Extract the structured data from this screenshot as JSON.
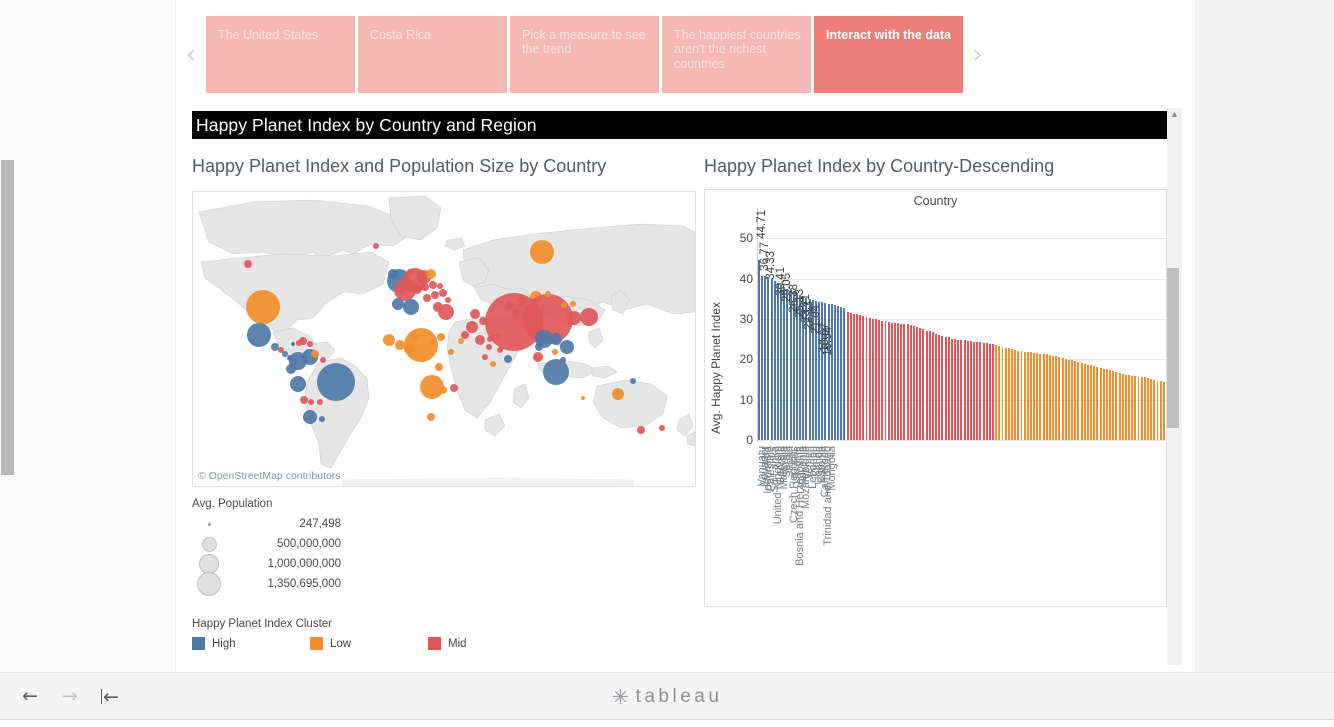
{
  "story": {
    "prev_icon": "chevron-left-icon",
    "next_icon": "chevron-right-icon",
    "tabs": [
      {
        "label": "The United States",
        "active": false
      },
      {
        "label": "Costa Rica",
        "active": false
      },
      {
        "label": "Pick a measure to see the trend",
        "active": false
      },
      {
        "label": "The happiest countries aren't the richest countries",
        "active": false
      },
      {
        "label": "Interact with the data",
        "active": true
      }
    ]
  },
  "dashboard": {
    "title": "Happy Planet Index by Country and Region",
    "map_sheet_title": "Happy Planet Index and Population Size by Country",
    "bar_sheet_title": "Happy Planet Index by Country-Descending",
    "map_attribution": "© OpenStreetMap contributors"
  },
  "legends": {
    "population": {
      "title": "Avg. Population",
      "items": [
        {
          "label": "247,498",
          "size": 3
        },
        {
          "label": "500,000,000",
          "size": 13
        },
        {
          "label": "1,000,000,000",
          "size": 18
        },
        {
          "label": "1,350,695,000",
          "size": 22
        }
      ]
    },
    "cluster": {
      "title": "Happy Planet Index Cluster",
      "items": [
        {
          "label": "High",
          "color": "#4E79A7"
        },
        {
          "label": "Low",
          "color": "#F28E2B"
        },
        {
          "label": "Mid",
          "color": "#E15759"
        }
      ]
    }
  },
  "colors": {
    "high": "#4E79A7",
    "low": "#F28E2B",
    "mid": "#E15759",
    "tab_inactive": "#f6b8b4",
    "tab_active": "#ee7e7a",
    "title_bar": "#000000"
  },
  "toolbar": {
    "back_icon": "arrow-left-icon",
    "forward_icon": "arrow-right-icon",
    "revert_icon": "revert-to-start-icon",
    "logo_text": "tableau"
  },
  "chart_data": {
    "type": "bar",
    "title": "Happy Planet Index by Country-Descending",
    "column_header": "Country",
    "xlabel": "Country",
    "ylabel": "Avg. Happy Planet Index",
    "ylim": [
      0,
      55
    ],
    "yticks": [
      0,
      10,
      20,
      30,
      40,
      50
    ],
    "grid": true,
    "legend_position": "below-map",
    "color_by": "Happy Planet Index Cluster",
    "labeled_points": [
      {
        "country": "Vanuatu",
        "value": 44.71
      },
      {
        "country": "Ecuador",
        "value": 36.77
      },
      {
        "country": "Palestine",
        "value": 34.33
      },
      {
        "country": "Georgia",
        "value": 30.41
      },
      {
        "country": "Serbia",
        "value": 29.05
      },
      {
        "country": "Czech Republic",
        "value": 26.38
      },
      {
        "country": "Bosnia and Herzegovina",
        "value": 25.13
      },
      {
        "country": "Mozambique",
        "value": 23.71
      },
      {
        "country": "Yemen",
        "value": 22.13
      },
      {
        "country": "Oman",
        "value": 21.04
      },
      {
        "country": "Cameroon",
        "value": 16.67
      },
      {
        "country": "Trinidad and Tobago",
        "value": 15.54
      }
    ],
    "tick_countries": [
      "Vanuatu",
      "Ecuador",
      "Indonesia",
      "Palestine",
      "Sri Lanka",
      "United Kingdom",
      "Georgia",
      "Malaysia",
      "Serbia",
      "Japan",
      "Czech Republic",
      "Ukraine",
      "Bosnia and Herzegovina",
      "Slovenia",
      "Mozambique",
      "Yemen",
      "Lebanon",
      "Oman",
      "Uganda",
      "Estonia",
      "Cameroon",
      "Trinidad and Tobago",
      "Mongolia"
    ],
    "categories": [
      "Vanuatu",
      "Ecuador",
      "Indonesia",
      "Palestine",
      "Sri Lanka",
      "United Kingdom",
      "Georgia",
      "Malaysia",
      "Serbia",
      "Japan",
      "Czech Republic",
      "Ukraine",
      "Bosnia and Herzegovina",
      "Slovenia",
      "Mozambique",
      "Yemen",
      "Lebanon",
      "Oman",
      "Uganda",
      "Estonia",
      "Cameroon",
      "Trinidad and Tobago",
      "Mongolia"
    ],
    "values": [
      44.71,
      40.7,
      40.6,
      40.5,
      39.9,
      39.3,
      38.9,
      38.4,
      37.9,
      37.4,
      37.1,
      36.77,
      36.4,
      36.0,
      35.6,
      35.2,
      34.9,
      34.6,
      34.33,
      34.2,
      34.1,
      34.0,
      33.8,
      33.6,
      33.4,
      33.2,
      33.0,
      32.8,
      31.6,
      31.4,
      31.2,
      31.1,
      31.0,
      30.8,
      30.41,
      30.3,
      30.1,
      30.0,
      29.8,
      29.6,
      29.4,
      29.2,
      29.05,
      28.9,
      28.9,
      28.8,
      28.8,
      28.7,
      28.5,
      28.3,
      28.0,
      27.7,
      27.4,
      27.1,
      26.9,
      26.7,
      26.38,
      26.1,
      25.8,
      25.6,
      25.4,
      25.13,
      25.0,
      24.9,
      24.8,
      24.7,
      24.6,
      24.5,
      24.4,
      24.3,
      24.2,
      24.1,
      24.0,
      23.9,
      23.71,
      23.5,
      23.3,
      23.1,
      22.9,
      22.7,
      22.5,
      22.3,
      22.13,
      22.0,
      21.9,
      21.8,
      21.7,
      21.6,
      21.5,
      21.4,
      21.3,
      21.2,
      21.04,
      20.9,
      20.7,
      20.5,
      20.3,
      20.1,
      19.9,
      19.7,
      19.5,
      19.3,
      19.1,
      18.9,
      18.7,
      18.5,
      18.3,
      18.1,
      17.9,
      17.7,
      17.5,
      17.3,
      17.1,
      16.9,
      16.67,
      16.4,
      16.2,
      16.0,
      15.9,
      15.8,
      15.7,
      15.6,
      15.54,
      15.3,
      15.1,
      14.9,
      14.7,
      14.5,
      14.3
    ],
    "clusters": [
      "High",
      "High",
      "High",
      "High",
      "High",
      "High",
      "High",
      "High",
      "High",
      "High",
      "High",
      "High",
      "High",
      "High",
      "High",
      "High",
      "High",
      "High",
      "High",
      "High",
      "High",
      "High",
      "High",
      "High",
      "High",
      "High",
      "High",
      "High",
      "Mid",
      "Mid",
      "Mid",
      "Mid",
      "Mid",
      "Mid",
      "Mid",
      "Mid",
      "Mid",
      "Mid",
      "Mid",
      "Mid",
      "Mid",
      "Mid",
      "Mid",
      "Mid",
      "Mid",
      "Mid",
      "Mid",
      "Mid",
      "Mid",
      "Mid",
      "Mid",
      "Mid",
      "Mid",
      "Mid",
      "Mid",
      "Mid",
      "Mid",
      "Mid",
      "Mid",
      "Mid",
      "Mid",
      "Mid",
      "Mid",
      "Mid",
      "Mid",
      "Mid",
      "Mid",
      "Mid",
      "Mid",
      "Mid",
      "Mid",
      "Mid",
      "Mid",
      "Mid",
      "Mid",
      "Low",
      "Low",
      "Low",
      "Low",
      "Low",
      "Low",
      "Low",
      "Low",
      "Low",
      "Low",
      "Low",
      "Low",
      "Low",
      "Low",
      "Low",
      "Low",
      "Low",
      "Low",
      "Low",
      "Low",
      "Low",
      "Low",
      "Low",
      "Low",
      "Low",
      "Low",
      "Low",
      "Low",
      "Low",
      "Low",
      "Low",
      "Low",
      "Low",
      "Low",
      "Low",
      "Low",
      "Low",
      "Low",
      "Low",
      "Low",
      "Low",
      "Low",
      "Low",
      "Low",
      "Low",
      "Low",
      "Low",
      "Low",
      "Low",
      "Low",
      "Low",
      "Low",
      "Low",
      "Low",
      "Low"
    ]
  },
  "map_data": {
    "type": "bubble-map",
    "size_field": "Avg. Population",
    "color_field": "Happy Planet Index Cluster",
    "bubbles": [
      {
        "x": 55,
        "y": 72,
        "r": 4,
        "c": "mid"
      },
      {
        "x": 70,
        "y": 115,
        "r": 17,
        "c": "low"
      },
      {
        "x": 66,
        "y": 143,
        "r": 12,
        "c": "high"
      },
      {
        "x": 82,
        "y": 155,
        "r": 4,
        "c": "high"
      },
      {
        "x": 88,
        "y": 158,
        "r": 3,
        "c": "mid"
      },
      {
        "x": 92,
        "y": 162,
        "r": 3,
        "c": "high"
      },
      {
        "x": 97,
        "y": 166,
        "r": 3,
        "c": "high"
      },
      {
        "x": 101,
        "y": 170,
        "r": 3,
        "c": "high"
      },
      {
        "x": 100,
        "y": 152,
        "r": 2,
        "c": "high"
      },
      {
        "x": 106,
        "y": 151,
        "r": 3,
        "c": "mid"
      },
      {
        "x": 110,
        "y": 149,
        "r": 4,
        "c": "mid"
      },
      {
        "x": 117,
        "y": 152,
        "r": 3,
        "c": "mid"
      },
      {
        "x": 105,
        "y": 169,
        "r": 9,
        "c": "high"
      },
      {
        "x": 98,
        "y": 177,
        "r": 5,
        "c": "high"
      },
      {
        "x": 117,
        "y": 165,
        "r": 8,
        "c": "high"
      },
      {
        "x": 122,
        "y": 162,
        "r": 4,
        "c": "low"
      },
      {
        "x": 130,
        "y": 168,
        "r": 3,
        "c": "mid"
      },
      {
        "x": 105,
        "y": 192,
        "r": 8,
        "c": "high"
      },
      {
        "x": 143,
        "y": 190,
        "r": 19,
        "c": "high"
      },
      {
        "x": 111,
        "y": 208,
        "r": 4,
        "c": "mid"
      },
      {
        "x": 118,
        "y": 210,
        "r": 3,
        "c": "mid"
      },
      {
        "x": 127,
        "y": 210,
        "r": 3,
        "c": "mid"
      },
      {
        "x": 117,
        "y": 225,
        "r": 7,
        "c": "high"
      },
      {
        "x": 129,
        "y": 227,
        "r": 3,
        "c": "high"
      },
      {
        "x": 183,
        "y": 54,
        "r": 3,
        "c": "mid"
      },
      {
        "x": 200,
        "y": 82,
        "r": 5,
        "c": "high"
      },
      {
        "x": 206,
        "y": 89,
        "r": 12,
        "c": "high"
      },
      {
        "x": 217,
        "y": 80,
        "r": 3,
        "c": "mid"
      },
      {
        "x": 222,
        "y": 88,
        "r": 12,
        "c": "mid"
      },
      {
        "x": 231,
        "y": 85,
        "r": 7,
        "c": "mid"
      },
      {
        "x": 238,
        "y": 82,
        "r": 5,
        "c": "low"
      },
      {
        "x": 212,
        "y": 98,
        "r": 11,
        "c": "mid"
      },
      {
        "x": 224,
        "y": 97,
        "r": 5,
        "c": "mid"
      },
      {
        "x": 232,
        "y": 95,
        "r": 4,
        "c": "mid"
      },
      {
        "x": 240,
        "y": 93,
        "r": 4,
        "c": "mid"
      },
      {
        "x": 247,
        "y": 94,
        "r": 3,
        "c": "mid"
      },
      {
        "x": 205,
        "y": 112,
        "r": 6,
        "c": "high"
      },
      {
        "x": 218,
        "y": 115,
        "r": 8,
        "c": "high"
      },
      {
        "x": 234,
        "y": 106,
        "r": 4,
        "c": "mid"
      },
      {
        "x": 242,
        "y": 103,
        "r": 4,
        "c": "mid"
      },
      {
        "x": 250,
        "y": 101,
        "r": 4,
        "c": "mid"
      },
      {
        "x": 255,
        "y": 108,
        "r": 3,
        "c": "mid"
      },
      {
        "x": 245,
        "y": 115,
        "r": 5,
        "c": "mid"
      },
      {
        "x": 253,
        "y": 120,
        "r": 8,
        "c": "mid"
      },
      {
        "x": 196,
        "y": 148,
        "r": 6,
        "c": "low"
      },
      {
        "x": 207,
        "y": 153,
        "r": 5,
        "c": "low"
      },
      {
        "x": 216,
        "y": 157,
        "r": 5,
        "c": "low"
      },
      {
        "x": 228,
        "y": 153,
        "r": 17,
        "c": "low"
      },
      {
        "x": 222,
        "y": 145,
        "r": 4,
        "c": "low"
      },
      {
        "x": 240,
        "y": 150,
        "r": 3,
        "c": "low"
      },
      {
        "x": 248,
        "y": 145,
        "r": 4,
        "c": "low"
      },
      {
        "x": 258,
        "y": 160,
        "r": 3,
        "c": "low"
      },
      {
        "x": 246,
        "y": 175,
        "r": 4,
        "c": "low"
      },
      {
        "x": 239,
        "y": 195,
        "r": 12,
        "c": "low"
      },
      {
        "x": 250,
        "y": 198,
        "r": 4,
        "c": "low"
      },
      {
        "x": 261,
        "y": 196,
        "r": 4,
        "c": "mid"
      },
      {
        "x": 238,
        "y": 225,
        "r": 4,
        "c": "low"
      },
      {
        "x": 282,
        "y": 122,
        "r": 5,
        "c": "mid"
      },
      {
        "x": 290,
        "y": 129,
        "r": 4,
        "c": "mid"
      },
      {
        "x": 279,
        "y": 135,
        "r": 6,
        "c": "mid"
      },
      {
        "x": 272,
        "y": 143,
        "r": 4,
        "c": "mid"
      },
      {
        "x": 268,
        "y": 149,
        "r": 3,
        "c": "low"
      },
      {
        "x": 287,
        "y": 148,
        "r": 5,
        "c": "mid"
      },
      {
        "x": 297,
        "y": 147,
        "r": 3,
        "c": "mid"
      },
      {
        "x": 305,
        "y": 145,
        "r": 3,
        "c": "mid"
      },
      {
        "x": 296,
        "y": 155,
        "r": 3,
        "c": "mid"
      },
      {
        "x": 307,
        "y": 158,
        "r": 3,
        "c": "mid"
      },
      {
        "x": 292,
        "y": 165,
        "r": 3,
        "c": "mid"
      },
      {
        "x": 300,
        "y": 172,
        "r": 3,
        "c": "low"
      },
      {
        "x": 316,
        "y": 113,
        "r": 4,
        "c": "high"
      },
      {
        "x": 323,
        "y": 120,
        "r": 4,
        "c": "mid"
      },
      {
        "x": 329,
        "y": 109,
        "r": 4,
        "c": "mid"
      },
      {
        "x": 334,
        "y": 116,
        "r": 3,
        "c": "mid"
      },
      {
        "x": 349,
        "y": 60,
        "r": 12,
        "c": "low"
      },
      {
        "x": 343,
        "y": 105,
        "r": 6,
        "c": "low"
      },
      {
        "x": 321,
        "y": 130,
        "r": 29,
        "c": "mid"
      },
      {
        "x": 355,
        "y": 127,
        "r": 25,
        "c": "mid"
      },
      {
        "x": 371,
        "y": 113,
        "r": 3,
        "c": "low"
      },
      {
        "x": 380,
        "y": 112,
        "r": 3,
        "c": "low"
      },
      {
        "x": 355,
        "y": 102,
        "r": 3,
        "c": "low"
      },
      {
        "x": 381,
        "y": 126,
        "r": 7,
        "c": "mid"
      },
      {
        "x": 396,
        "y": 125,
        "r": 9,
        "c": "mid"
      },
      {
        "x": 527,
        "y": 125,
        "r": 3,
        "c": "mid"
      },
      {
        "x": 351,
        "y": 147,
        "r": 9,
        "c": "high"
      },
      {
        "x": 346,
        "y": 155,
        "r": 4,
        "c": "high"
      },
      {
        "x": 363,
        "y": 147,
        "r": 6,
        "c": "high"
      },
      {
        "x": 374,
        "y": 155,
        "r": 7,
        "c": "high"
      },
      {
        "x": 345,
        "y": 165,
        "r": 5,
        "c": "mid"
      },
      {
        "x": 362,
        "y": 160,
        "r": 3,
        "c": "low"
      },
      {
        "x": 370,
        "y": 168,
        "r": 3,
        "c": "high"
      },
      {
        "x": 363,
        "y": 180,
        "r": 13,
        "c": "high"
      },
      {
        "x": 315,
        "y": 167,
        "r": 4,
        "c": "high"
      },
      {
        "x": 337,
        "y": 141,
        "r": 3,
        "c": "mid"
      },
      {
        "x": 440,
        "y": 189,
        "r": 3,
        "c": "high"
      },
      {
        "x": 425,
        "y": 202,
        "r": 6,
        "c": "low"
      },
      {
        "x": 448,
        "y": 238,
        "r": 4,
        "c": "mid"
      },
      {
        "x": 469,
        "y": 236,
        "r": 3,
        "c": "mid"
      },
      {
        "x": 390,
        "y": 206,
        "r": 2,
        "c": "low"
      }
    ]
  }
}
